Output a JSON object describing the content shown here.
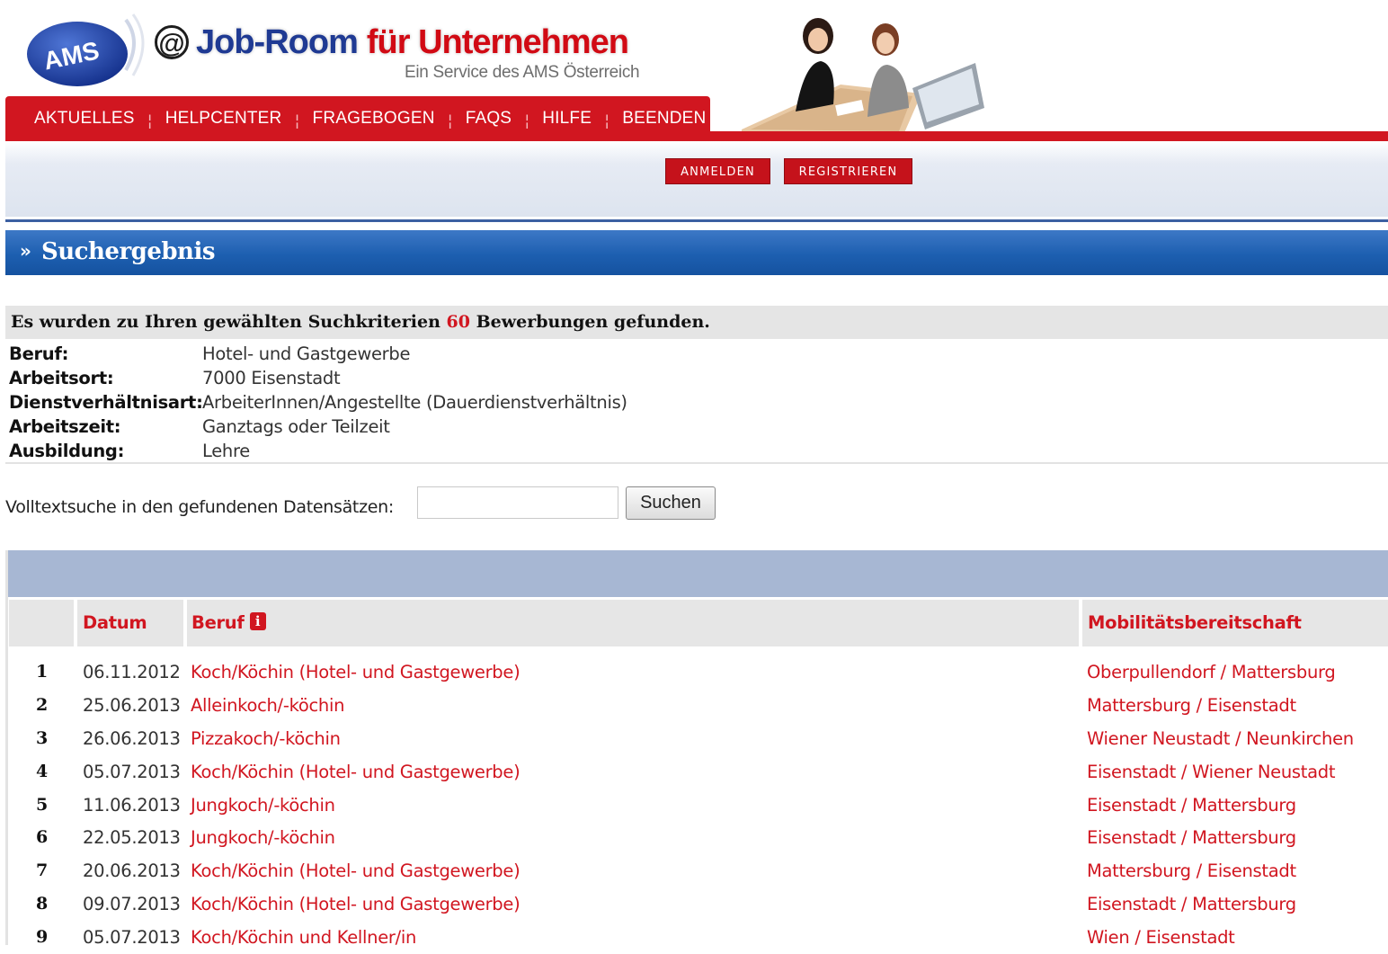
{
  "header": {
    "logo_text": "AMS",
    "brand_at": "@",
    "brand_part1": "Job-Room",
    "brand_part2": "für Unternehmen",
    "tagline": "Ein Service des AMS Österreich",
    "nav": [
      "AKTUELLES",
      "HELPCENTER",
      "FRAGEBOGEN",
      "FAQS",
      "HILFE",
      "BEENDEN"
    ],
    "brand_red": "#d11620",
    "brand_blue": "#1f3a93"
  },
  "auth": {
    "login_label": "ANMELDEN",
    "register_label": "REGISTRIEREN"
  },
  "section": {
    "chevron": "»",
    "title": "Suchergebnis"
  },
  "summary": {
    "prefix": "Es wurden zu Ihren gewählten Suchkriterien",
    "count": "60",
    "suffix": "Bewerbungen gefunden."
  },
  "criteria": [
    {
      "label": "Beruf:",
      "value": "Hotel- und Gastgewerbe"
    },
    {
      "label": "Arbeitsort:",
      "value": "7000 Eisenstadt"
    },
    {
      "label": "Dienstverhältnisart:",
      "value": "ArbeiterInnen/Angestellte (Dauerdienstverhältnis)"
    },
    {
      "label": "Arbeitszeit:",
      "value": "Ganztags oder Teilzeit"
    },
    {
      "label": "Ausbildung:",
      "value": "Lehre"
    }
  ],
  "search": {
    "label": "Volltextsuche in den gefundenen Datensätzen:",
    "value": "",
    "button": "Suchen"
  },
  "table": {
    "columns": {
      "date": "Datum",
      "job": "Beruf",
      "info_icon": "i",
      "mobility": "Mobilitätsbereitschaft"
    },
    "rows": [
      {
        "num": "1",
        "date": "06.11.2012",
        "job": "Koch/Köchin (Hotel- und Gastgewerbe)",
        "mobility": "Oberpullendorf / Mattersburg"
      },
      {
        "num": "2",
        "date": "25.06.2013",
        "job": "Alleinkoch/-köchin",
        "mobility": "Mattersburg / Eisenstadt"
      },
      {
        "num": "3",
        "date": "26.06.2013",
        "job": "Pizzakoch/-köchin",
        "mobility": "Wiener Neustadt / Neunkirchen"
      },
      {
        "num": "4",
        "date": "05.07.2013",
        "job": "Koch/Köchin (Hotel- und Gastgewerbe)",
        "mobility": "Eisenstadt / Wiener Neustadt"
      },
      {
        "num": "5",
        "date": "11.06.2013",
        "job": "Jungkoch/-köchin",
        "mobility": "Eisenstadt / Mattersburg"
      },
      {
        "num": "6",
        "date": "22.05.2013",
        "job": "Jungkoch/-köchin",
        "mobility": "Eisenstadt / Mattersburg"
      },
      {
        "num": "7",
        "date": "20.06.2013",
        "job": "Koch/Köchin (Hotel- und Gastgewerbe)",
        "mobility": "Mattersburg / Eisenstadt"
      },
      {
        "num": "8",
        "date": "09.07.2013",
        "job": "Koch/Köchin (Hotel- und Gastgewerbe)",
        "mobility": "Eisenstadt / Mattersburg"
      },
      {
        "num": "9",
        "date": "05.07.2013",
        "job": "Koch/Köchin und Kellner/in",
        "mobility": "Wien / Eisenstadt"
      }
    ]
  }
}
